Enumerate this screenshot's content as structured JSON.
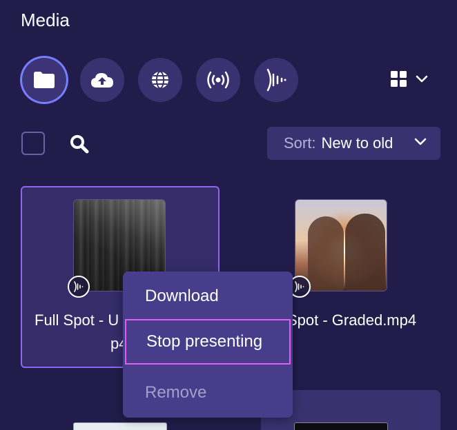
{
  "header": {
    "title": "Media"
  },
  "sources": [
    {
      "icon": "folder-icon",
      "active": true
    },
    {
      "icon": "cloud-upload-icon",
      "active": false
    },
    {
      "icon": "globe-icon",
      "active": false
    },
    {
      "icon": "broadcast-icon",
      "active": false
    },
    {
      "icon": "audio-wave-icon",
      "active": false
    }
  ],
  "toolbar": {
    "sort_label": "Sort:",
    "sort_value": "New to old"
  },
  "cards": [
    {
      "name_line1": "Full Spot - U",
      "name_line2": "p4",
      "selected": true
    },
    {
      "name": "Spot - Graded.mp4",
      "selected": false
    }
  ],
  "context_menu": {
    "items": [
      {
        "label": "Download",
        "enabled": true
      },
      {
        "label": "Stop presenting",
        "enabled": true,
        "focused": true
      },
      {
        "label": "Remove",
        "enabled": false
      }
    ]
  },
  "colors": {
    "background": "#221c4a",
    "accent": "#8f66f2",
    "focus_outline": "#e35cf0",
    "button_bg": "#3a3170",
    "menu_bg": "#473d8a"
  }
}
